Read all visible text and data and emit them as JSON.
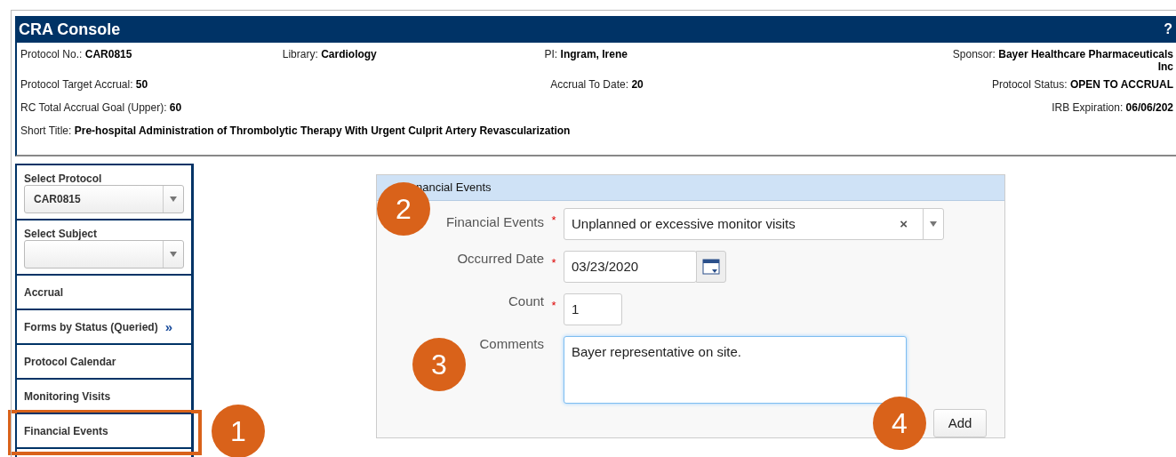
{
  "window": {
    "title": "CRA Console",
    "help": "?"
  },
  "info_rows": [
    {
      "fields": [
        {
          "label": "Protocol No.:",
          "value": "CAR0815"
        },
        {
          "label": "Library:",
          "value": "Cardiology"
        },
        {
          "label": "PI:",
          "value": "Ingram, Irene"
        },
        {
          "label": "Sponsor:",
          "value": "Bayer Healthcare Pharmaceuticals",
          "value_line_2": "Inc"
        }
      ]
    },
    {
      "fields": [
        {
          "label": "Protocol Target Accrual:",
          "value": "50"
        },
        {
          "label": "Accrual To Date:",
          "value": "20"
        },
        {
          "label": "Protocol Status:",
          "value": "OPEN TO ACCRUAL"
        }
      ]
    },
    {
      "fields": [
        {
          "label": "RC Total Accrual Goal (Upper):",
          "value": "60"
        },
        {
          "label": "IRB Expiration:",
          "value": "06/06/202"
        }
      ]
    },
    {
      "fields": [
        {
          "label": "Short Title:",
          "value": "Pre-hospital Administration of Thrombolytic Therapy With Urgent Culprit Artery Revascularization"
        }
      ]
    }
  ],
  "sidebar": {
    "items": [
      {
        "kind": "select",
        "label": "Select Protocol",
        "value": "CAR0815"
      },
      {
        "kind": "select",
        "label": "Select Subject"
      },
      {
        "kind": "link",
        "label": "Accrual",
        "highlighted": false
      },
      {
        "kind": "link",
        "label": "Forms by Status (Queried)",
        "more": "»",
        "highlighted": false
      },
      {
        "kind": "link",
        "label": "Protocol Calendar",
        "highlighted": false
      },
      {
        "kind": "link",
        "label": "Monitoring Visits",
        "highlighted": false
      },
      {
        "kind": "link",
        "label": "Financial Events",
        "highlighted": true
      }
    ]
  },
  "form": {
    "title": "nancial Events",
    "fields": [
      {
        "kind": "select",
        "label": "Financial Events",
        "required_mark": "*",
        "value": "Unplanned or excessive monitor visits",
        "clear": "×"
      },
      {
        "kind": "date",
        "label": "Occurred Date",
        "required_mark": "*",
        "value": "03/23/2020"
      },
      {
        "kind": "number",
        "label": "Count",
        "required_mark": "*",
        "value": "1"
      },
      {
        "kind": "textarea",
        "label": "Comments",
        "value": "Bayer representative on site."
      }
    ],
    "button": "Add"
  },
  "callouts": [
    "1",
    "2",
    "3",
    "4"
  ]
}
